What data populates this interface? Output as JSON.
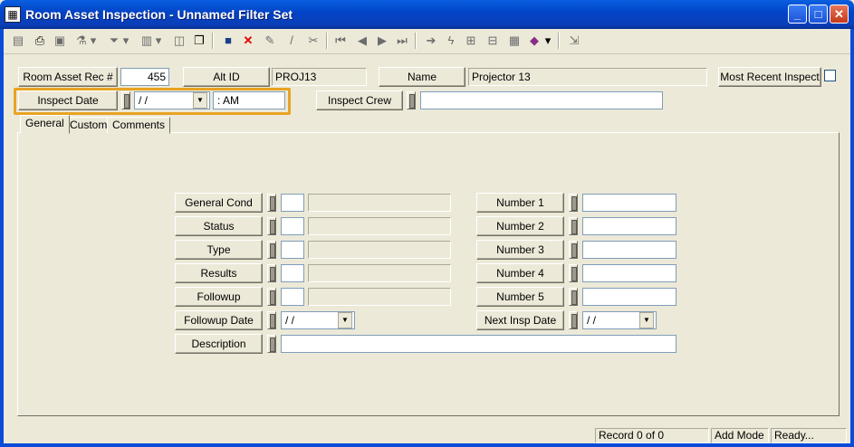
{
  "window": {
    "title": "Room Asset Inspection - Unnamed Filter Set",
    "minimize": "_",
    "maximize": "□",
    "close": "✕"
  },
  "toolbar": {
    "icons": [
      "grid-icon",
      "printer-icon",
      "print-preview-icon",
      "filter-icon",
      "funnel-icon",
      "page-icon",
      "copy-icon",
      "form-icon",
      "save-icon",
      "delete-icon",
      "edit-book-icon",
      "pencil-icon",
      "scissors-icon",
      "first-icon",
      "prev-icon",
      "next-icon",
      "last-icon",
      "arrow-icon",
      "lightning-icon",
      "network-icon",
      "tree-icon",
      "list-icon",
      "book-icon",
      "export-icon"
    ]
  },
  "header": {
    "room_asset_label": "Room Asset Rec #",
    "room_asset_value": "455",
    "alt_id_label": "Alt ID",
    "alt_id_value": "PROJ13",
    "name_label": "Name",
    "name_value": "Projector 13",
    "most_recent_label": "Most Recent Inspect",
    "inspect_date_label": "Inspect Date",
    "inspect_date_value": " / /",
    "inspect_time_value": " :  AM",
    "inspect_crew_label": "Inspect Crew",
    "inspect_crew_value": ""
  },
  "tabs": [
    {
      "label": "General"
    },
    {
      "label": "Custom"
    },
    {
      "label": "Comments"
    }
  ],
  "general": {
    "left_fields": [
      {
        "label": "General Cond"
      },
      {
        "label": "Status"
      },
      {
        "label": "Type"
      },
      {
        "label": "Results"
      },
      {
        "label": "Followup"
      }
    ],
    "followup_date_label": "Followup Date",
    "followup_date_value": " / /",
    "description_label": "Description",
    "right_fields": [
      {
        "label": "Number 1"
      },
      {
        "label": "Number 2"
      },
      {
        "label": "Number 3"
      },
      {
        "label": "Number 4"
      },
      {
        "label": "Number 5"
      }
    ],
    "next_insp_date_label": "Next Insp Date",
    "next_insp_date_value": " / /"
  },
  "status": {
    "record": "Record 0 of 0",
    "mode": "Add Mode",
    "state": "Ready..."
  },
  "colors": {
    "title_bar": "#0245c8",
    "highlight": "#e8a323",
    "delete": "#e00000",
    "save": "#1a3f8a"
  }
}
